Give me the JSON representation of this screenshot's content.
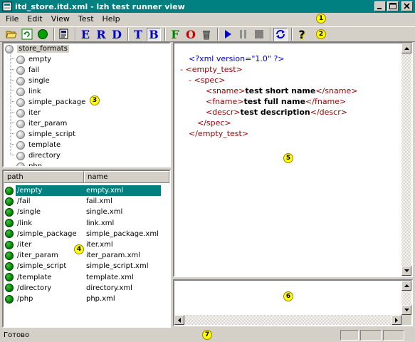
{
  "window": {
    "title": "itd_store.itd.xml - lzh test runner view"
  },
  "menu": [
    "File",
    "Edit",
    "View",
    "Test",
    "Help"
  ],
  "toolbar": {
    "buttons": [
      {
        "name": "open-icon",
        "glyph": ""
      },
      {
        "name": "refresh-icon",
        "glyph": ""
      },
      {
        "name": "run-green-icon",
        "glyph": ""
      },
      {
        "name": "properties-icon",
        "glyph": ""
      },
      {
        "name": "e-button",
        "glyph": "E",
        "color": "#0000cc"
      },
      {
        "name": "r-button",
        "glyph": "R",
        "color": "#0000cc"
      },
      {
        "name": "d-button",
        "glyph": "D",
        "color": "#0000cc"
      },
      {
        "name": "t-button",
        "glyph": "T",
        "color": "#0000cc"
      },
      {
        "name": "b-button",
        "glyph": "B",
        "color": "#0000cc"
      },
      {
        "name": "f-button",
        "glyph": "F",
        "color": "#008000"
      },
      {
        "name": "o-button",
        "glyph": "O",
        "color": "#cc0000"
      },
      {
        "name": "trash-icon",
        "glyph": ""
      },
      {
        "name": "play-icon",
        "glyph": ""
      },
      {
        "name": "pause-icon",
        "glyph": ""
      },
      {
        "name": "stop-icon",
        "glyph": ""
      },
      {
        "name": "loop-icon",
        "glyph": ""
      },
      {
        "name": "help-icon",
        "glyph": "?"
      }
    ]
  },
  "badges": [
    "1",
    "2",
    "3",
    "4",
    "5",
    "6",
    "7"
  ],
  "tree": {
    "root": "store_formats",
    "items": [
      "empty",
      "fail",
      "single",
      "link",
      "simple_package",
      "iter",
      "iter_param",
      "simple_script",
      "template",
      "directory",
      "php"
    ]
  },
  "grid": {
    "columns": [
      "path",
      "name"
    ],
    "rows": [
      {
        "path": "/empty",
        "name": "empty.xml"
      },
      {
        "path": "/fail",
        "name": "fail.xml"
      },
      {
        "path": "/single",
        "name": "single.xml"
      },
      {
        "path": "/link",
        "name": "link.xml"
      },
      {
        "path": "/simple_package",
        "name": "simple_package.xml"
      },
      {
        "path": "/iter",
        "name": "iter.xml"
      },
      {
        "path": "/iter_param",
        "name": "iter_param.xml"
      },
      {
        "path": "/simple_script",
        "name": "simple_script.xml"
      },
      {
        "path": "/template",
        "name": "template.xml"
      },
      {
        "path": "/directory",
        "name": "directory.xml"
      },
      {
        "path": "/php",
        "name": "php.xml"
      }
    ],
    "selected_index": 0
  },
  "xml": {
    "pi": "<?xml version=\"1.0\" ?>",
    "root_open": "<empty_test>",
    "spec_open": "<spec>",
    "sname_open": "<sname>",
    "sname_text": "test short name",
    "sname_close": "</sname>",
    "fname_open": "<fname>",
    "fname_text": "test full name",
    "fname_close": "</fname>",
    "descr_open": "<descr>",
    "descr_text": "test description",
    "descr_close": "</descr>",
    "spec_close": "</spec>",
    "root_close": "</empty_test>",
    "collapse_glyph": "-"
  },
  "status": {
    "text": "Готово"
  }
}
